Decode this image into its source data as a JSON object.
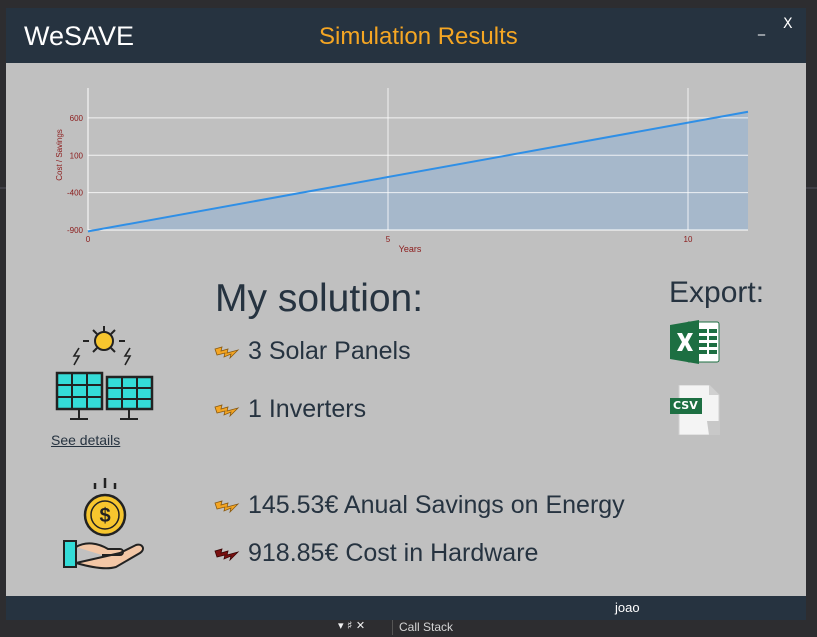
{
  "window": {
    "app_name": "WeSAVE",
    "title": "Simulation Results",
    "minimize": "_",
    "close": "X"
  },
  "chart_data": {
    "type": "area",
    "xlabel": "Years",
    "ylabel": "Cost / Savings",
    "x_ticks": [
      0,
      5,
      10
    ],
    "y_ticks": [
      -900,
      -400,
      100,
      600
    ],
    "xlim": [
      0,
      11
    ],
    "ylim": [
      -900,
      1000
    ],
    "grid": true,
    "series": [
      {
        "x": [
          0,
          11
        ],
        "values": [
          -918.85,
          682
        ]
      }
    ],
    "colors": {
      "line": "#2f8fe6",
      "fill": "#a6b8cb",
      "axis_text": "#8b1a1a"
    }
  },
  "solution": {
    "title": "My solution:",
    "items": [
      {
        "text": "3 Solar Panels",
        "icon": "lightning-bolt-icon"
      },
      {
        "text": "1 Inverters",
        "icon": "lightning-bolt-icon"
      }
    ],
    "see_details": "See details"
  },
  "summary": {
    "savings": "145.53€ Anual Savings on Energy",
    "cost": "918.85€ Cost in Hardware"
  },
  "export": {
    "label": "Export:",
    "excel_icon": "excel-icon",
    "csv_icon": "csv-icon",
    "csv_text": "CSV"
  },
  "status": {
    "user": "joao"
  },
  "ide": {
    "callstack": "Call Stack",
    "tools": "▾ ♯ ✕"
  },
  "colors": {
    "titlebar": "#263340",
    "accent": "#f5a623",
    "body": "#c0c0c0"
  }
}
